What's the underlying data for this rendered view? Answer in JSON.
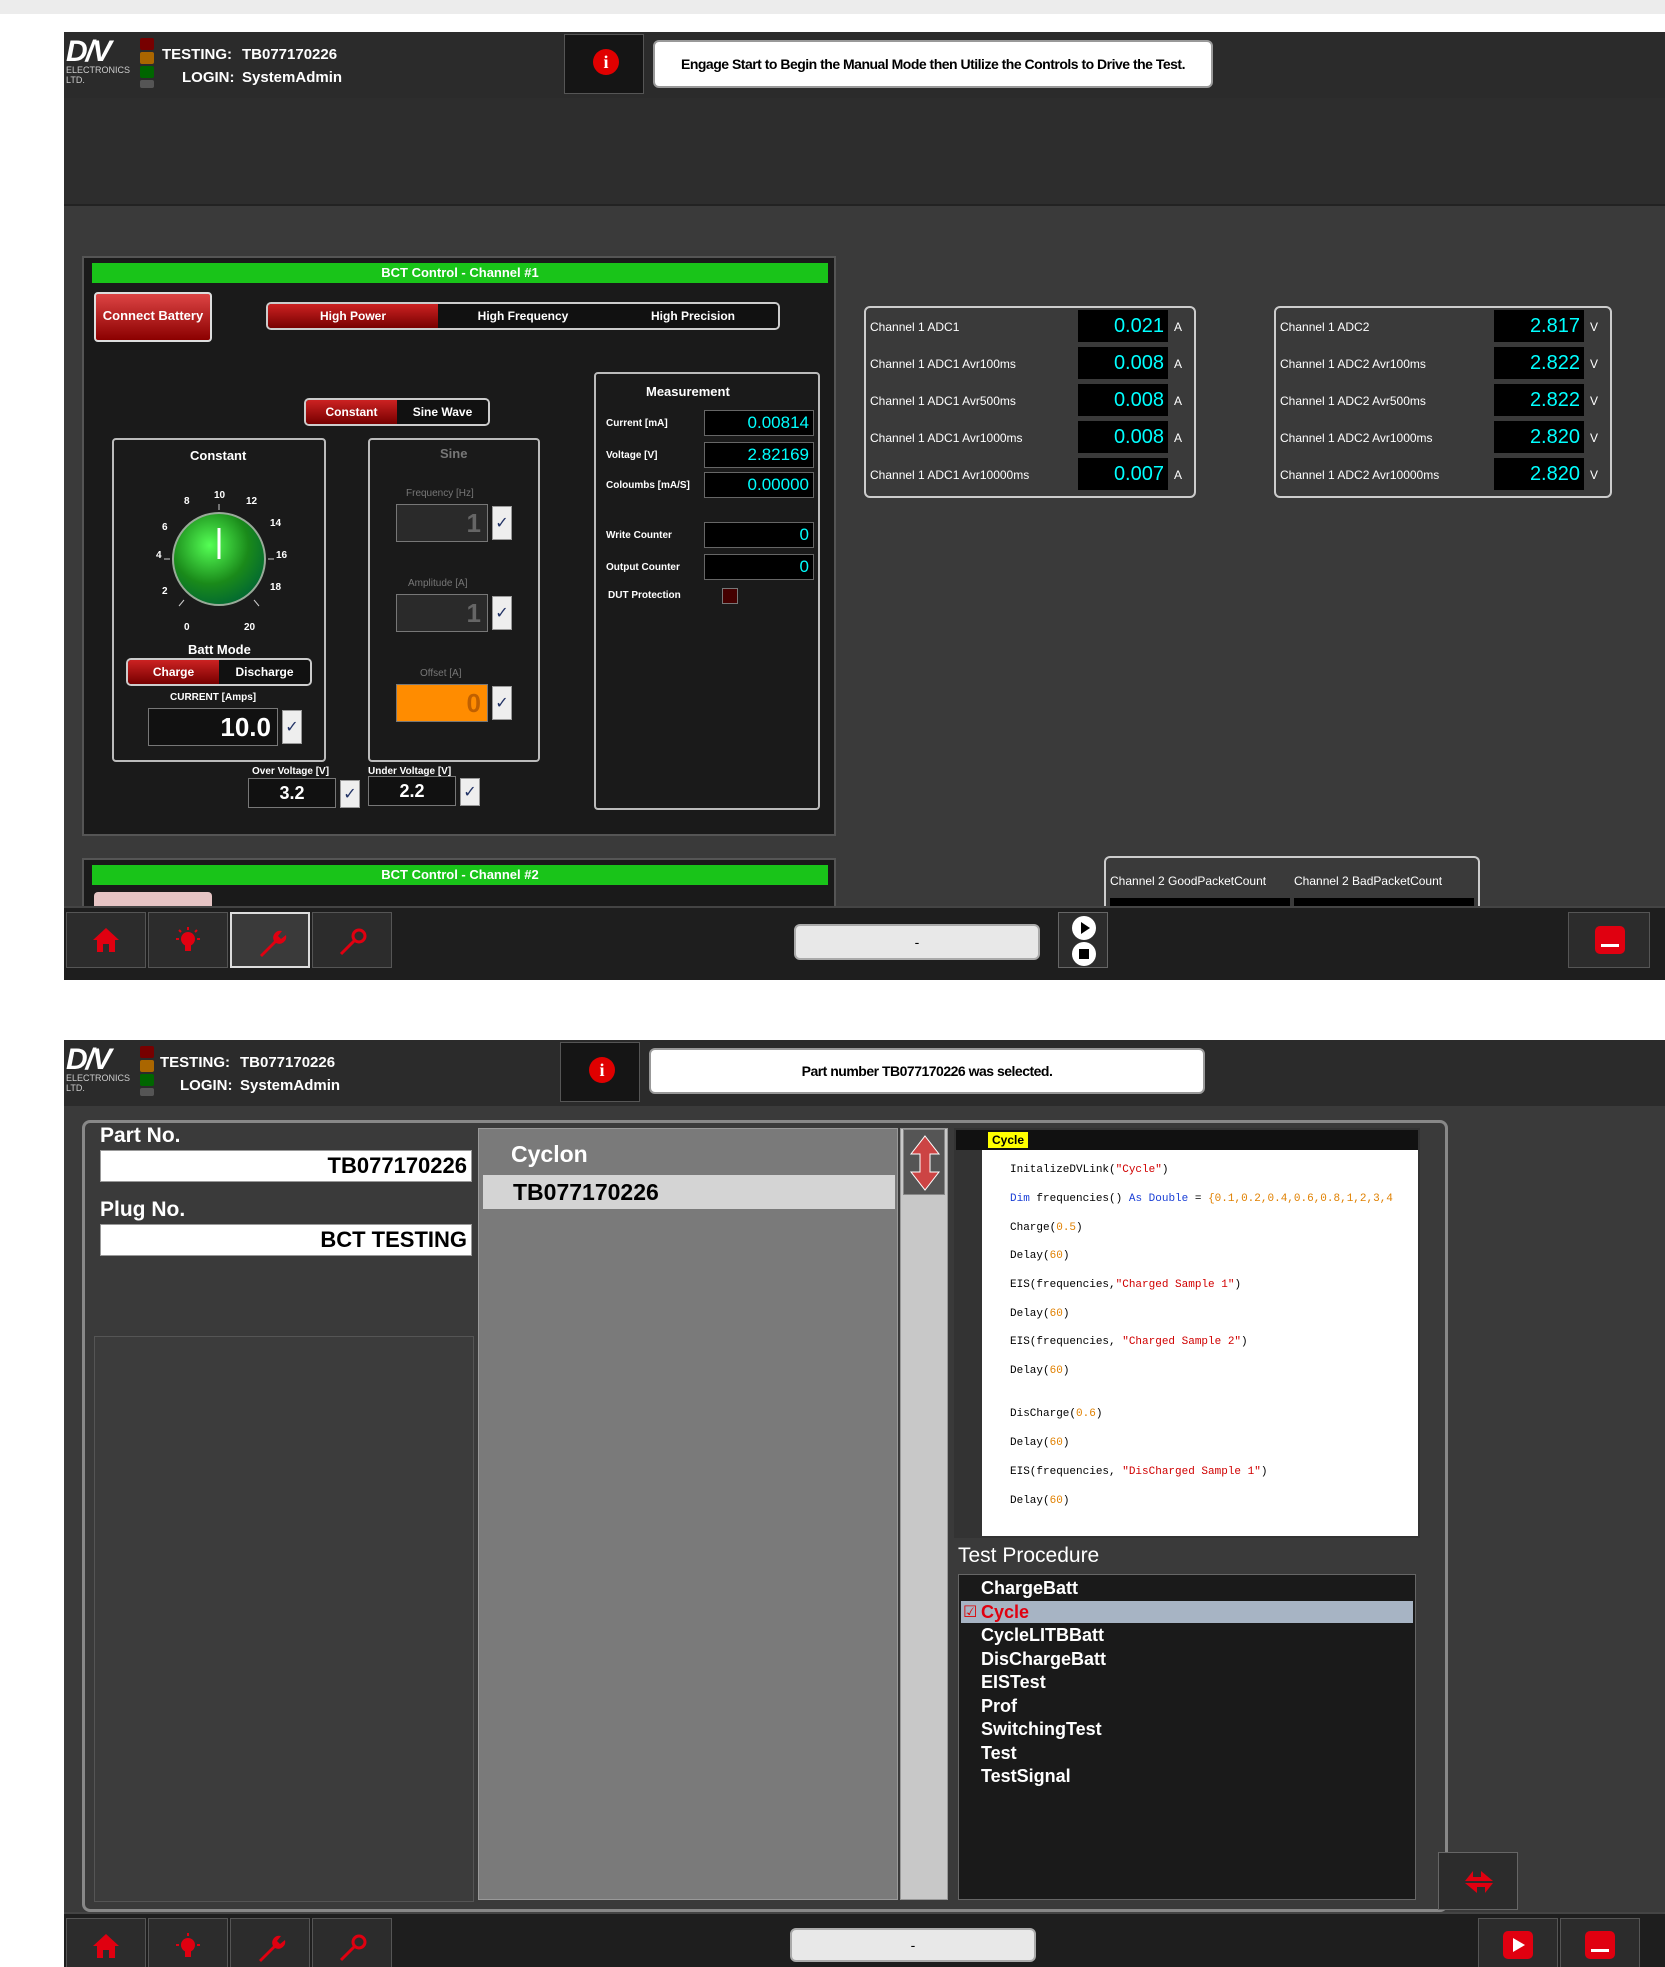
{
  "header": {
    "logo_text": "D/V",
    "logo_sub": "ELECTRONICS LTD.",
    "testing_label": "TESTING:",
    "testing_value": "TB077170226",
    "login_label": "LOGIN:",
    "login_value": "SystemAdmin",
    "info_icon": "info-icon"
  },
  "screen1": {
    "message": "Engage Start to Begin the Manual Mode then Utilize the Controls to Drive the Test.",
    "ch1_title": "BCT Control - Channel #1",
    "ch2_title": "BCT Control - Channel #2",
    "connect_battery": "Connect Battery",
    "modes": [
      "High Power",
      "High Frequency",
      "High Precision"
    ],
    "wave_modes": [
      "Constant",
      "Sine Wave"
    ],
    "constant_title": "Constant",
    "dial_ticks": [
      "0",
      "2",
      "4",
      "6",
      "8",
      "10",
      "12",
      "14",
      "16",
      "18",
      "20"
    ],
    "sine_title": "Sine",
    "frequency_label": "Frequency [Hz]",
    "frequency_value": "1",
    "amplitude_label": "Amplitude [A]",
    "amplitude_value": "1",
    "offset_label": "Offset [A]",
    "offset_value": "0",
    "batt_mode_title": "Batt Mode",
    "batt_modes": [
      "Charge",
      "Discharge"
    ],
    "current_label": "CURRENT [Amps]",
    "current_value": "10.0",
    "over_voltage_label": "Over Voltage [V]",
    "over_voltage_value": "3.2",
    "under_voltage_label": "Under Voltage [V]",
    "under_voltage_value": "2.2",
    "measurement": {
      "title": "Measurement",
      "current_label": "Current [mA]",
      "current_value": "0.00814",
      "voltage_label": "Voltage [V]",
      "voltage_value": "2.82169",
      "coulombs_label": "Coloumbs [mA/S]",
      "coulombs_value": "0.00000",
      "write_counter_label": "Write Counter",
      "write_counter_value": "0",
      "output_counter_label": "Output Counter",
      "output_counter_value": "0",
      "dut_protection_label": "DUT Protection"
    },
    "adc1": [
      {
        "label": "Channel 1 ADC1",
        "value": "0.021",
        "unit": "A"
      },
      {
        "label": "Channel 1 ADC1 Avr100ms",
        "value": "0.008",
        "unit": "A"
      },
      {
        "label": "Channel 1 ADC1 Avr500ms",
        "value": "0.008",
        "unit": "A"
      },
      {
        "label": "Channel 1 ADC1 Avr1000ms",
        "value": "0.008",
        "unit": "A"
      },
      {
        "label": "Channel 1 ADC1 Avr10000ms",
        "value": "0.007",
        "unit": "A"
      }
    ],
    "adc2": [
      {
        "label": "Channel 1 ADC2",
        "value": "2.817",
        "unit": "V"
      },
      {
        "label": "Channel 1 ADC2 Avr100ms",
        "value": "2.822",
        "unit": "V"
      },
      {
        "label": "Channel 1 ADC2 Avr500ms",
        "value": "2.822",
        "unit": "V"
      },
      {
        "label": "Channel 1 ADC2 Avr1000ms",
        "value": "2.820",
        "unit": "V"
      },
      {
        "label": "Channel 1 ADC2 Avr10000ms",
        "value": "2.820",
        "unit": "V"
      }
    ],
    "packet_good": "Channel 2 GoodPacketCount",
    "packet_bad": "Channel 2 BadPacketCount",
    "status_pill": "-"
  },
  "screen2": {
    "message": "Part number TB077170226 was selected.",
    "part_no_label": "Part No.",
    "part_no_value": "TB077170226",
    "plug_no_label": "Plug No.",
    "plug_no_value": "BCT TESTING",
    "list_title": "Cyclon",
    "list_item": "TB077170226",
    "code_tab": "Cycle",
    "code_lines": [
      {
        "pre": "InitalizeDVLink(",
        "str": "\"Cycle\"",
        "post": ")"
      },
      {
        "kw": "Dim",
        "pre": " frequencies() ",
        "kw2": "As Double",
        "post": " = ",
        "num": "{0.1,0.2,0.4,0.6,0.8,1,2,3,4"
      },
      {
        "pre": "Charge(",
        "num": "0.5",
        "post": ")"
      },
      {
        "pre": "Delay(",
        "num": "60",
        "post": ")"
      },
      {
        "pre": "EIS(frequencies,",
        "str": "\"Charged Sample 1\"",
        "post": ")"
      },
      {
        "pre": "Delay(",
        "num": "60",
        "post": ")"
      },
      {
        "pre": "EIS(frequencies, ",
        "str": "\"Charged Sample 2\"",
        "post": ")"
      },
      {
        "pre": "Delay(",
        "num": "60",
        "post": ")"
      },
      {
        "pre": "DisCharge(",
        "num": "0.6",
        "post": ")"
      },
      {
        "pre": "Delay(",
        "num": "60",
        "post": ")"
      },
      {
        "pre": "EIS(frequencies, ",
        "str": "\"DisCharged Sample 1\"",
        "post": ")"
      },
      {
        "pre": "Delay(",
        "num": "60",
        "post": ")"
      }
    ],
    "procedure_title": "Test Procedure",
    "procedures": [
      "ChargeBatt",
      "Cycle",
      "CycleLITBBatt",
      "DisChargeBatt",
      "EISTest",
      "Prof",
      "SwitchingTest",
      "Test",
      "TestSignal"
    ],
    "selected_procedure": "Cycle",
    "status_pill": "-"
  },
  "colors": {
    "accent_red": "#e00010",
    "accent_green": "#19c419",
    "value_cyan": "#00ffff",
    "offset_orange": "#ff8c00"
  }
}
